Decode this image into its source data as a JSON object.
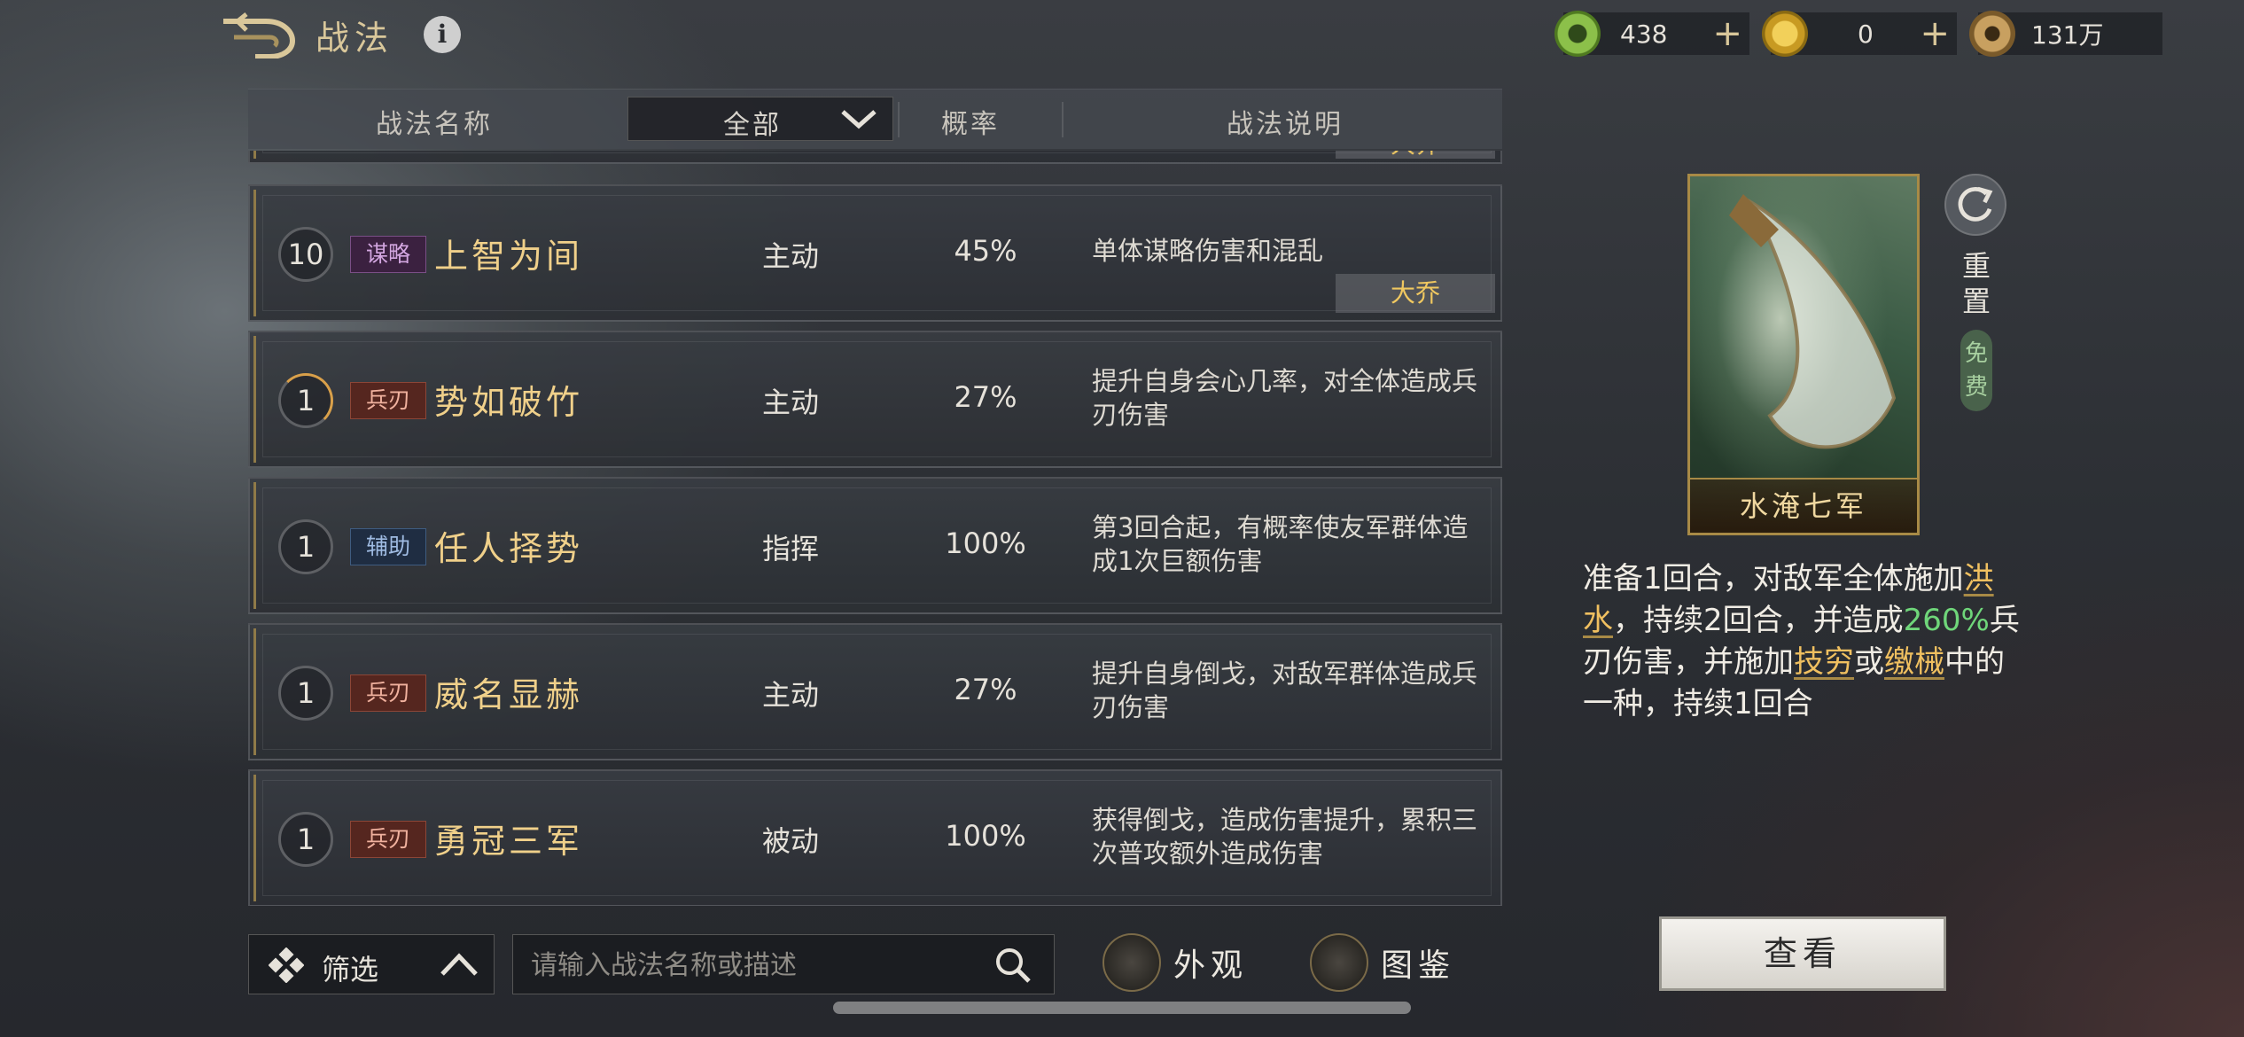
{
  "header": {
    "title": "战法",
    "info_label": "i"
  },
  "currencies": [
    {
      "icon": "jade-coin-icon",
      "value": "438",
      "plus": "+"
    },
    {
      "icon": "gold-coin-icon",
      "value": "0",
      "plus": "+"
    },
    {
      "icon": "copper-coin-icon",
      "value": "131万",
      "plus": ""
    }
  ],
  "list_header": {
    "name": "战法名称",
    "filter": "全部",
    "rate": "概率",
    "desc": "战法说明"
  },
  "peek_row": {
    "owner": "大乔"
  },
  "rows": [
    {
      "level": "10",
      "type": "谋略",
      "type_class": "strategy",
      "name": "上智为间",
      "category": "主动",
      "rate": "45%",
      "desc": "单体谋略伤害和混乱",
      "owner": "大乔"
    },
    {
      "level": "1",
      "type": "兵刃",
      "type_class": "weapon",
      "name": "势如破竹",
      "category": "主动",
      "rate": "27%",
      "desc": "提升自身会心几率，对全体造成兵刃伤害",
      "owner": ""
    },
    {
      "level": "1",
      "type": "辅助",
      "type_class": "assist",
      "name": "任人择势",
      "category": "指挥",
      "rate": "100%",
      "desc": "第3回合起，有概率使友军群体造成1次巨额伤害",
      "owner": ""
    },
    {
      "level": "1",
      "type": "兵刃",
      "type_class": "weapon",
      "name": "威名显赫",
      "category": "主动",
      "rate": "27%",
      "desc": "提升自身倒戈，对敌军群体造成兵刃伤害",
      "owner": ""
    },
    {
      "level": "1",
      "type": "兵刃",
      "type_class": "weapon",
      "name": "勇冠三军",
      "category": "被动",
      "rate": "100%",
      "desc": "获得倒戈，造成伤害提升，累积三次普攻额外造成伤害",
      "owner": ""
    }
  ],
  "detail": {
    "card_name": "水淹七军",
    "reset_label": "重置",
    "free_label": "免费",
    "desc_parts": {
      "p1": "准备1回合，对敌军全体施加",
      "k1": "洪水",
      "p2": "，持续2回合，并造成",
      "k2": "260%",
      "p3": "兵刃伤害，并施加",
      "k3": "技穷",
      "p4": "或",
      "k4": "缴械",
      "p5": "中的一种，持续1回合"
    }
  },
  "bottom": {
    "filter_label": "筛选",
    "search_placeholder": "请输入战法名称或描述",
    "appearance_label": "外观",
    "codex_label": "图鉴",
    "view_label": "查看"
  },
  "colors": {
    "gold_text": "#f0d08a",
    "accent_gold": "#a88a46",
    "highlight_green": "#6fd67a"
  }
}
